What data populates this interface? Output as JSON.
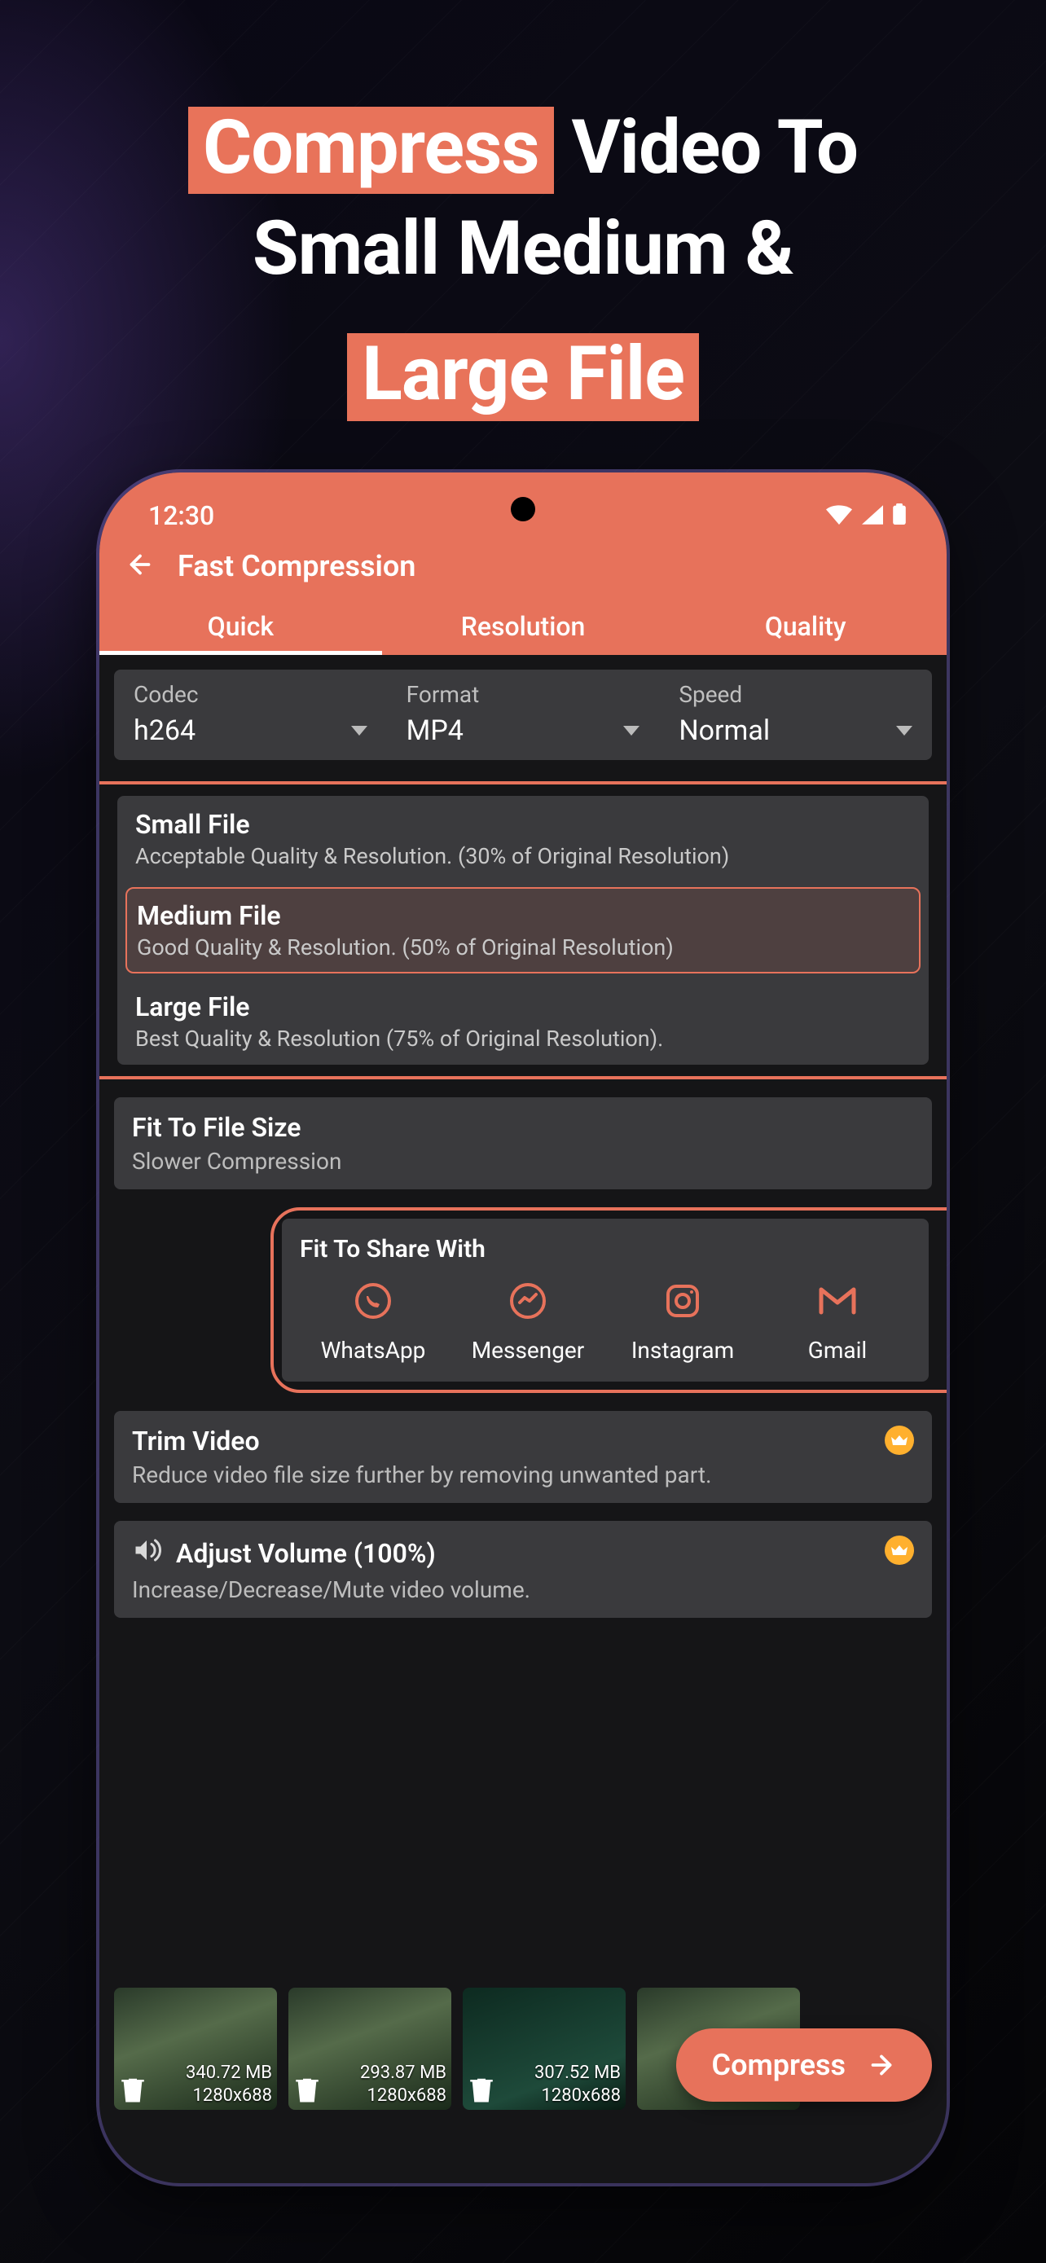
{
  "headline": {
    "word1": "Compress",
    "word2": "Video To",
    "line2": "Small Medium &",
    "word3": "Large File"
  },
  "statusbar": {
    "time": "12:30"
  },
  "appbar": {
    "title": "Fast Compression"
  },
  "tabs": {
    "quick": "Quick",
    "resolution": "Resolution",
    "quality": "Quality"
  },
  "dropdowns": {
    "codec": {
      "label": "Codec",
      "value": "h264"
    },
    "format": {
      "label": "Format",
      "value": "MP4"
    },
    "speed": {
      "label": "Speed",
      "value": "Normal"
    }
  },
  "presets": {
    "small": {
      "title": "Small File",
      "sub": "Acceptable Quality & Resolution. (30% of Original Resolution)"
    },
    "medium": {
      "title": "Medium File",
      "sub": "Good Quality & Resolution. (50% of Original Resolution)"
    },
    "large": {
      "title": "Large File",
      "sub": "Best Quality & Resolution (75% of Original Resolution)."
    }
  },
  "fit_size": {
    "title": "Fit To File Size",
    "sub": "Slower Compression"
  },
  "share": {
    "title": "Fit To Share With",
    "items": {
      "whatsapp": "WhatsApp",
      "messenger": "Messenger",
      "instagram": "Instagram",
      "gmail": "Gmail"
    }
  },
  "trim": {
    "title": "Trim Video",
    "sub": "Reduce video file size further by removing unwanted part."
  },
  "volume": {
    "title": "Adjust Volume (100%)",
    "sub": "Increase/Decrease/Mute video volume."
  },
  "thumbs": [
    {
      "size": "340.72 MB",
      "dims": "1280x688"
    },
    {
      "size": "293.87 MB",
      "dims": "1280x688"
    },
    {
      "size": "307.52 MB",
      "dims": "1280x688"
    }
  ],
  "compress_label": "Compress",
  "colors": {
    "accent": "#e7725b"
  }
}
